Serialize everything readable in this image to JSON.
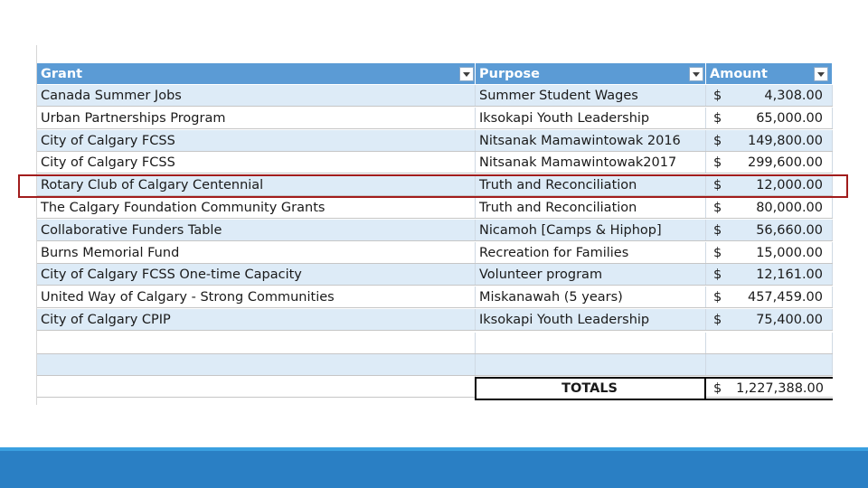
{
  "table": {
    "headers": {
      "grant": "Grant",
      "purpose": "Purpose",
      "amount": "Amount"
    },
    "currency_symbol": "$",
    "rows": [
      {
        "grant": "Canada Summer Jobs",
        "purpose": "Summer Student Wages",
        "amount": "4,308.00"
      },
      {
        "grant": "Urban Partnerships Program",
        "purpose": "Iksokapi Youth Leadership",
        "amount": "65,000.00"
      },
      {
        "grant": "City of Calgary FCSS",
        "purpose": "Nitsanak Mamawintowak 2016",
        "amount": "149,800.00"
      },
      {
        "grant": "City of Calgary FCSS",
        "purpose": "Nitsanak Mamawintowak2017",
        "amount": "299,600.00"
      },
      {
        "grant": "Rotary Club of Calgary Centennial",
        "purpose": "Truth and Reconciliation",
        "amount": "12,000.00"
      },
      {
        "grant": "The Calgary Foundation Community Grants",
        "purpose": "Truth and Reconciliation",
        "amount": "80,000.00"
      },
      {
        "grant": "Collaborative Funders Table",
        "purpose": "Nicamoh [Camps & Hiphop]",
        "amount": "56,660.00"
      },
      {
        "grant": "Burns Memorial Fund",
        "purpose": "Recreation for Families",
        "amount": "15,000.00"
      },
      {
        "grant": "City of Calgary FCSS One-time Capacity",
        "purpose": "Volunteer program",
        "amount": "12,161.00"
      },
      {
        "grant": "United Way of Calgary - Strong Communities",
        "purpose": "Miskanawah (5 years)",
        "amount": "457,459.00"
      },
      {
        "grant": "City of Calgary CPIP",
        "purpose": "Iksokapi Youth Leadership",
        "amount": "75,400.00"
      }
    ],
    "totals": {
      "label": "TOTALS",
      "amount": "1,227,388.00"
    }
  },
  "colors": {
    "header": "#5b9bd5",
    "band": "#ddebf7",
    "highlight": "#a11c1c",
    "footer_bar": "#2a7fc4"
  }
}
